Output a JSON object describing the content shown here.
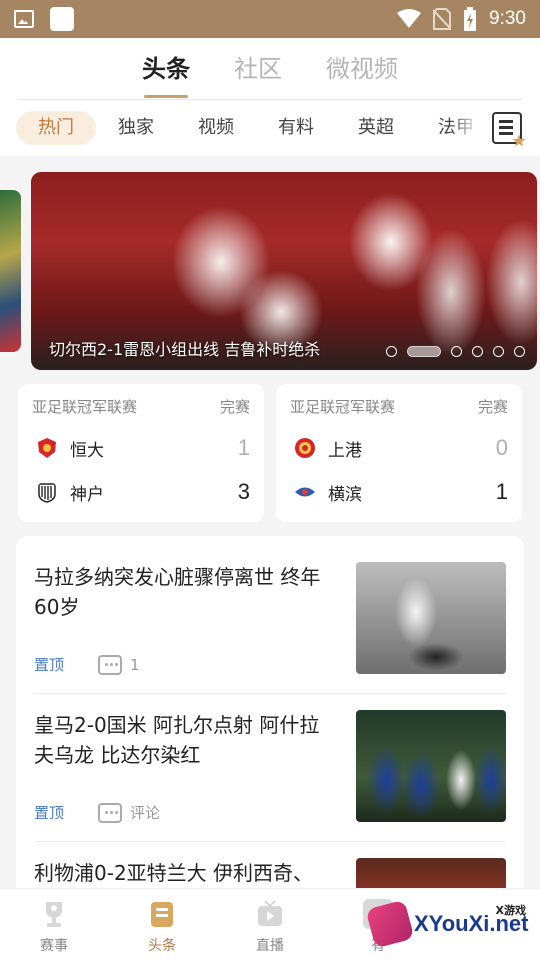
{
  "status_bar": {
    "time": "9:30"
  },
  "top_tabs": [
    {
      "label": "头条",
      "active": true
    },
    {
      "label": "社区",
      "active": false
    },
    {
      "label": "微视频",
      "active": false
    }
  ],
  "category_tabs": [
    "热门",
    "独家",
    "视频",
    "有料",
    "英超",
    "法甲"
  ],
  "banner": {
    "title": "切尔西2-1雷恩小组出线 吉鲁补时绝杀",
    "page_count": 6,
    "active_page": 1
  },
  "matches": [
    {
      "league": "亚足联冠军联赛",
      "status": "完赛",
      "home": {
        "name": "恒大",
        "score": "1"
      },
      "away": {
        "name": "神户",
        "score": "3"
      }
    },
    {
      "league": "亚足联冠军联赛",
      "status": "完赛",
      "home": {
        "name": "上港",
        "score": "0"
      },
      "away": {
        "name": "横滨",
        "score": "1"
      }
    }
  ],
  "news": [
    {
      "title": "马拉多纳突发心脏骤停离世 终年60岁",
      "tag": "置顶",
      "comments": "1"
    },
    {
      "title": "皇马2-0国米 阿扎尔点射 阿什拉夫乌龙 比达尔染红",
      "tag": "置顶",
      "comments": "评论"
    },
    {
      "title": "利物浦0-2亚特兰大 伊利西奇、",
      "tag": "",
      "comments": ""
    }
  ],
  "bottom_nav": [
    {
      "label": "赛事",
      "active": false
    },
    {
      "label": "头条",
      "active": true
    },
    {
      "label": "直播",
      "active": false
    },
    {
      "label": "有",
      "active": false
    }
  ],
  "watermark": {
    "text": "XYouXi.net",
    "small": "X游戏"
  },
  "colors": {
    "status_bar": "#a68662",
    "accent": "#c0793c",
    "tag_blue": "#4a7cc2"
  }
}
